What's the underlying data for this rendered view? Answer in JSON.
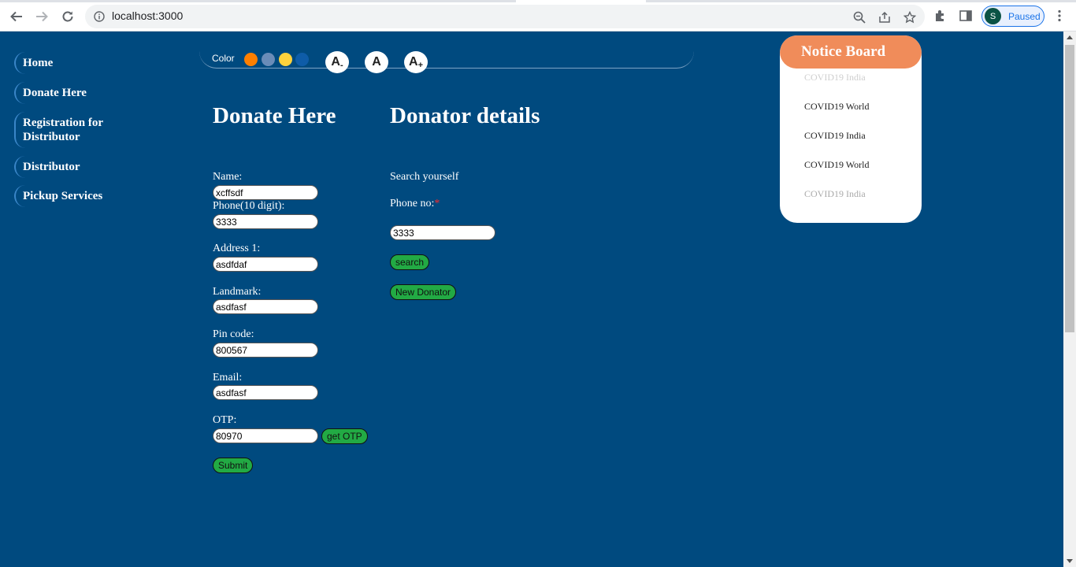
{
  "browser": {
    "url": "localhost:3000",
    "profile_initial": "S",
    "profile_status": "Paused"
  },
  "sidebar": {
    "items": [
      {
        "label": "Home"
      },
      {
        "label": "Donate Here"
      },
      {
        "label": "Registration for Distributor"
      },
      {
        "label": "Distributor"
      },
      {
        "label": "Pickup Services"
      }
    ]
  },
  "toolbar": {
    "color_label": "Color",
    "swatches": [
      "#ff7f00",
      "#6a8cb8",
      "#ffd23c",
      "#0e5ca8"
    ],
    "font_decrease": "A",
    "font_decrease_sub": "-",
    "font_reset": "A",
    "font_increase": "A",
    "font_increase_sub": "+"
  },
  "donate_form": {
    "title": "Donate Here",
    "name_label": "Name:",
    "name_value": "xcffsdf",
    "phone_label": "Phone(10 digit):",
    "phone_value": "3333",
    "address_label": "Address 1:",
    "address_value": "asdfdaf",
    "landmark_label": "Landmark:",
    "landmark_value": "asdfasf",
    "pin_label": "Pin code:",
    "pin_value": "800567",
    "email_label": "Email:",
    "email_value": "asdfasf",
    "otp_label": "OTP:",
    "otp_value": "80970",
    "get_otp_button": "get OTP",
    "submit_button": "Submit"
  },
  "donator_details": {
    "title": "Donator details",
    "search_label": "Search yourself",
    "phone_label": "Phone no:",
    "required_mark": "*",
    "phone_value": "3333",
    "search_button": "search",
    "new_donator_button": "New Donator"
  },
  "notice_board": {
    "title": "Notice Board",
    "items": [
      "COVID19 World",
      "COVID19 India",
      "COVID19 World",
      "COVID19 India"
    ]
  },
  "colors": {
    "page_background": "#004a7f",
    "button_green": "#22aa44",
    "notice_header": "#f08c5a"
  }
}
